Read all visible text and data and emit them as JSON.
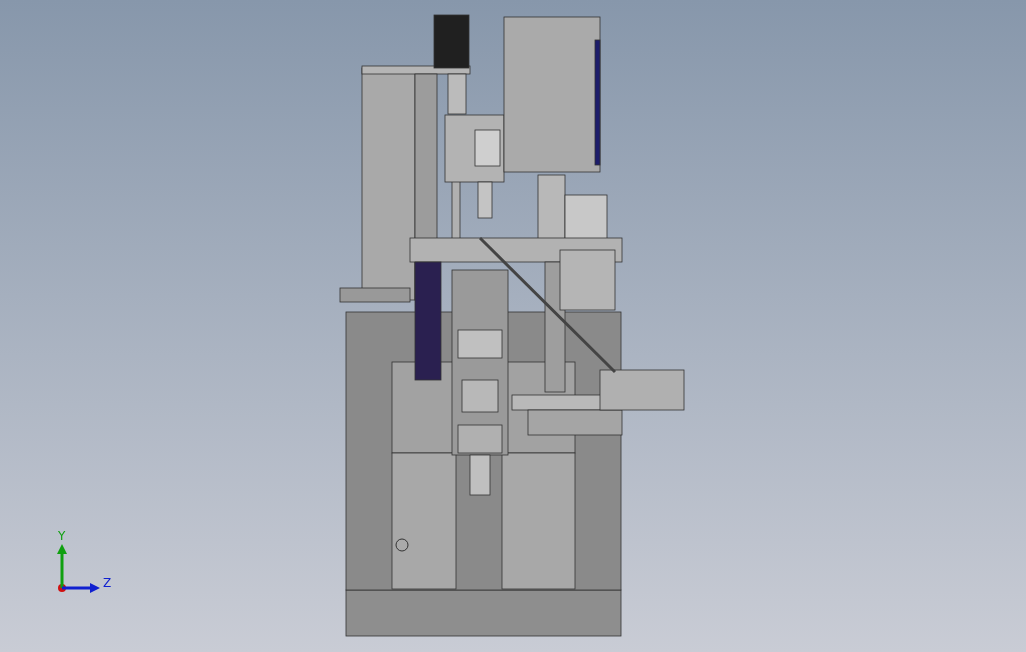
{
  "viewport": {
    "triad": {
      "axes": [
        {
          "label": "Y",
          "kind": "vertical",
          "color": "#10a010"
        },
        {
          "label": "Z",
          "kind": "horizontal",
          "color": "#1020d0"
        }
      ]
    }
  }
}
